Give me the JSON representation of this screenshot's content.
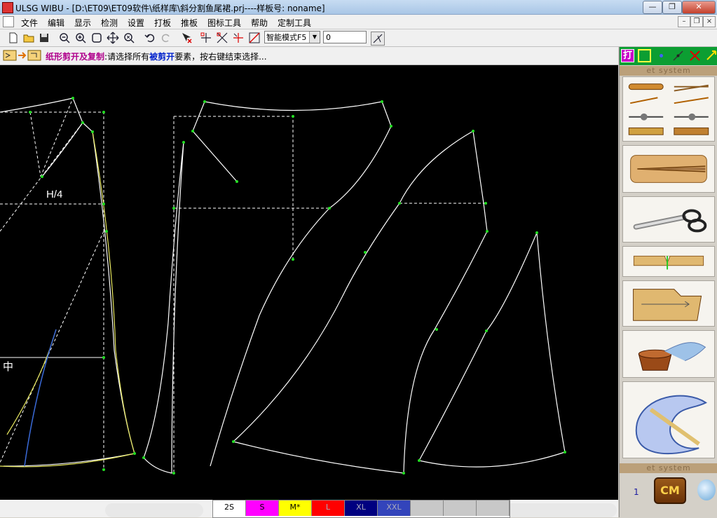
{
  "window": {
    "title": "ULSG WIBU - [D:\\ET09\\ET09软件\\纸样库\\斜分割鱼尾裙.prj----样板号: noname]",
    "controls": [
      "—",
      "❐",
      "✕"
    ]
  },
  "menu": {
    "items": [
      "文件",
      "编辑",
      "显示",
      "检测",
      "设置",
      "打板",
      "推板",
      "图标工具",
      "帮助",
      "定制工具"
    ],
    "mdi_controls": [
      "–",
      "❐",
      "×"
    ]
  },
  "toolbar": {
    "mode_value": "智能模式F5",
    "number_value": "0"
  },
  "hint": {
    "function_name": "纸形剪开及复制",
    "colon": ":",
    "text_before": "请选择所有",
    "highlight": "被剪开",
    "text_after": "要素，按右键结束选择..."
  },
  "canvas": {
    "labels": {
      "h4": "H/4",
      "center": "中"
    },
    "colors": {
      "background": "#000000",
      "line": "#ffffff",
      "dashed": "#ffffff",
      "point": "#22dd22",
      "yellow": "#e8e860",
      "blue": "#3a6ad8"
    }
  },
  "right_panel": {
    "watermark_top": "et system",
    "watermark_bottom": "et system",
    "tools": [
      "measure-pen-tool",
      "dart-tool",
      "scissors-cut-tool",
      "notch-tool",
      "pattern-piece-tool",
      "wash-shrink-tool",
      "curve-ruler-tool"
    ],
    "page_number": "1",
    "unit_button": "CM"
  },
  "sizes": {
    "items": [
      {
        "label": "2S",
        "color": "#ffffff"
      },
      {
        "label": "S",
        "color": "#ff00ff"
      },
      {
        "label": "M*",
        "color": "#ffff00"
      },
      {
        "label": "L",
        "color": "#ff0000"
      },
      {
        "label": "XL",
        "color": "#000080"
      },
      {
        "label": "XXL",
        "color": "#3344bb"
      },
      {
        "label": "",
        "color": "#c8c8c8"
      },
      {
        "label": "",
        "color": "#c8c8c8"
      },
      {
        "label": "",
        "color": "#c8c8c8"
      }
    ]
  }
}
